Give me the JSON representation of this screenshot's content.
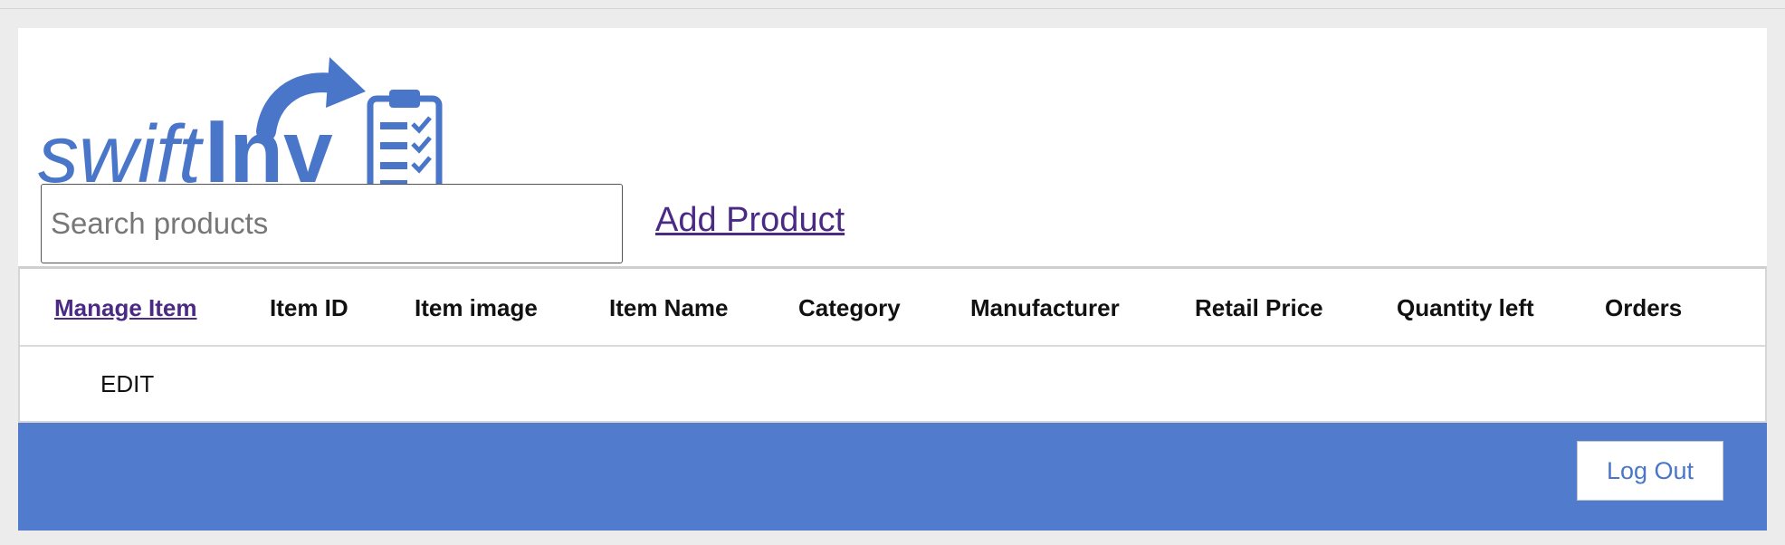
{
  "brand": {
    "logo_text_light": "swift",
    "logo_text_bold": "Inv",
    "primary_color": "#4a76c9",
    "footer_color": "#517bcd"
  },
  "search": {
    "placeholder": "Search products",
    "value": ""
  },
  "actions": {
    "add_product": "Add Product"
  },
  "table": {
    "columns": [
      "Manage Item",
      "Item ID",
      "Item image",
      "Item Name",
      "Category",
      "Manufacturer",
      "Retail Price",
      "Quantity left",
      "Orders"
    ],
    "rows": [
      {
        "manage": "EDIT"
      }
    ]
  },
  "footer": {
    "logout_label": "Log Out"
  }
}
